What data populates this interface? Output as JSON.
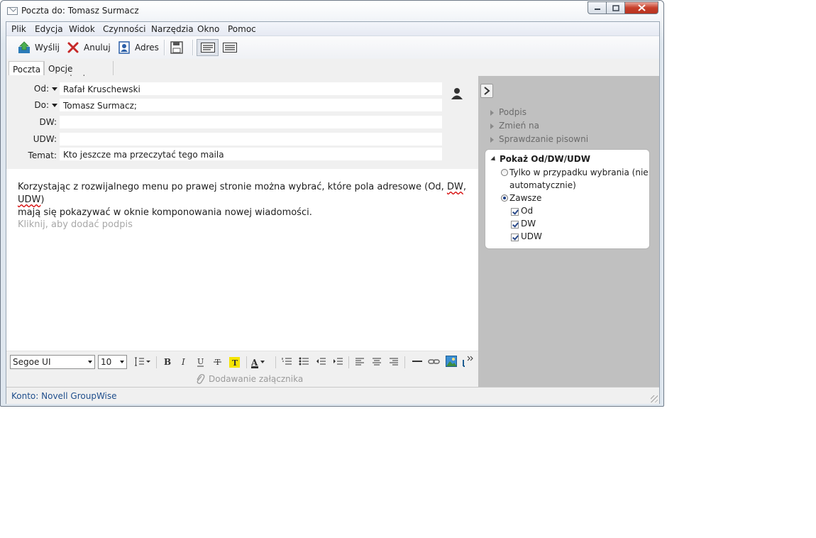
{
  "window": {
    "title": "Poczta do: Tomasz Surmacz"
  },
  "menu": [
    "Plik",
    "Edycja",
    "Widok",
    "Czynności",
    "Narzędzia",
    "Okno",
    "Pomoc"
  ],
  "toolbar": {
    "send_label": "Wyślij",
    "cancel_label": "Anuluj",
    "address_label": "Adres"
  },
  "tabs": [
    "Poczta",
    "Opcje wysyłania"
  ],
  "header": {
    "from_label": "Od:",
    "from_value": "Rafał Kruschewski",
    "to_label": "Do:",
    "to_value": "Tomasz Surmacz;",
    "cc_label": "DW:",
    "cc_value": "",
    "bcc_label": "UDW:",
    "bcc_value": "",
    "subject_label": "Temat:",
    "subject_value": "Kto jeszcze ma przeczytać tego maila"
  },
  "message": {
    "line1_a": "Korzystając z rozwijalnego menu po prawej stronie  można wybrać, które pola adresowe (Od, ",
    "line1_dw": "DW",
    "line1_sep": ", ",
    "line1_udw": "UDW",
    "line1_end": ")",
    "line2": "mają się pokazywać w oknie komponowania nowej wiadomości.",
    "signature_hint": "Kliknij, aby dodać podpis"
  },
  "format": {
    "font_family": "Segoe UI",
    "font_size": "10"
  },
  "attachment_label": "Dodawanie załącznika",
  "sidepanel": {
    "items": [
      "Podpis",
      "Zmień na",
      "Sprawdzanie pisowni"
    ],
    "group_title": "Pokaż Od/DW/UDW",
    "option_selected_only_line1": "Tylko w przypadku wybrania (nie",
    "option_selected_only_line2": "automatycznie)",
    "option_always": "Zawsze",
    "always_selected": true,
    "checkboxes": [
      {
        "label": "Od",
        "checked": true
      },
      {
        "label": "DW",
        "checked": true
      },
      {
        "label": "UDW",
        "checked": true
      }
    ]
  },
  "status": {
    "account": "Konto: Novell GroupWise"
  }
}
